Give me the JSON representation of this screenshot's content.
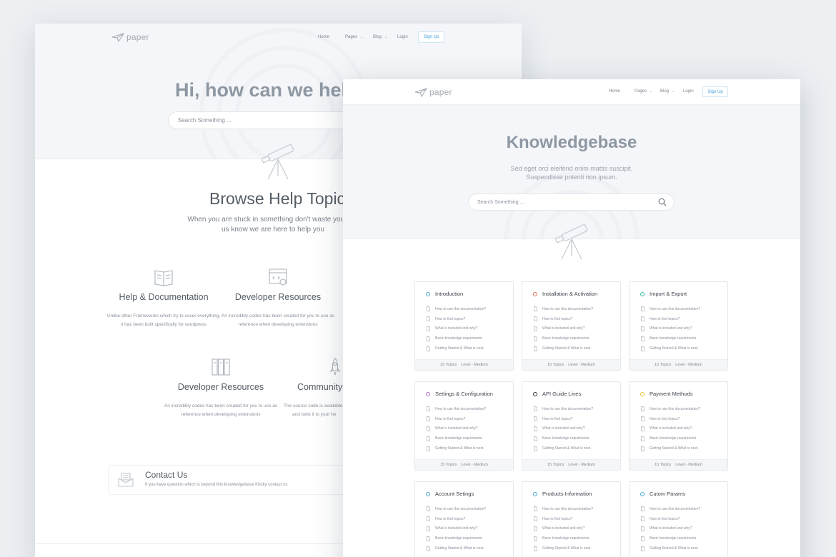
{
  "nav": {
    "logo_text": "paper",
    "items": [
      {
        "label": "Home",
        "has_caret": false
      },
      {
        "label": "Pages",
        "has_caret": true
      },
      {
        "label": "Blog",
        "has_caret": true
      },
      {
        "label": "Login",
        "has_caret": false
      }
    ],
    "signup_label": "Sign Up"
  },
  "back_page": {
    "hero_title": "Hi, how can we help y",
    "search_placeholder": "Search Something ...",
    "browse_title": "Browse Help Topics",
    "browse_sub_line1": "When you are stuck in something don't waste your tim",
    "browse_sub_line2": "us know we are here to help you",
    "features": [
      {
        "icon": "book-icon",
        "title": "Help & Documentation",
        "desc_line1": "Unlike other Frameworks which try to cover everything,",
        "desc_line2": "it has been built specifically for wordpress"
      },
      {
        "icon": "code-window-icon",
        "title": "Developer Resources",
        "desc_line1": "An incredibly codex has been created for you to use as",
        "desc_line2": "reference when developing extensions"
      },
      {
        "icon": "binders-icon",
        "title": "Developer Resources",
        "desc_line1": "An incredibly codex has been created for you to use as",
        "desc_line2": "reference when developing extensions"
      },
      {
        "icon": "rocket-icon",
        "title": "Community",
        "desc_line1": "The source code is available on",
        "desc_line2": "and twist it to your he"
      }
    ],
    "contact": {
      "title": "Contact Us",
      "sub": "If you have question which is beyond this knowledgebase Kindly contact us"
    }
  },
  "front_page": {
    "title": "Knowledgebase",
    "sub_line1": "Sed eget orci eleifend enim mattis suscipit.",
    "sub_line2": "Suspendisse potenti non ipsum.",
    "search_placeholder": "Search Something ...",
    "cards": [
      {
        "title": "Introduction",
        "color": "#3ea7d6"
      },
      {
        "title": "Installation & Activation",
        "color": "#e36a55"
      },
      {
        "title": "Import & Export",
        "color": "#2fb89a"
      },
      {
        "title": "Settings & Configuration",
        "color": "#b56ac3"
      },
      {
        "title": "API Guide Lines",
        "color": "#2d3136"
      },
      {
        "title": "Payment Methods",
        "color": "#e6c43a"
      },
      {
        "title": "Account Setings",
        "color": "#3ea7d6"
      },
      {
        "title": "Products Information",
        "color": "#3ea7d6"
      },
      {
        "title": "Cutom Params",
        "color": "#3ea7d6"
      }
    ],
    "card_items": [
      "How to use this documentation?",
      "How to find topics?",
      "What is included and why?",
      "Basic knowledge requirments.",
      "Getting Started & What is next."
    ],
    "card_topics": "15 Topics",
    "card_level": "Level - Medium"
  }
}
